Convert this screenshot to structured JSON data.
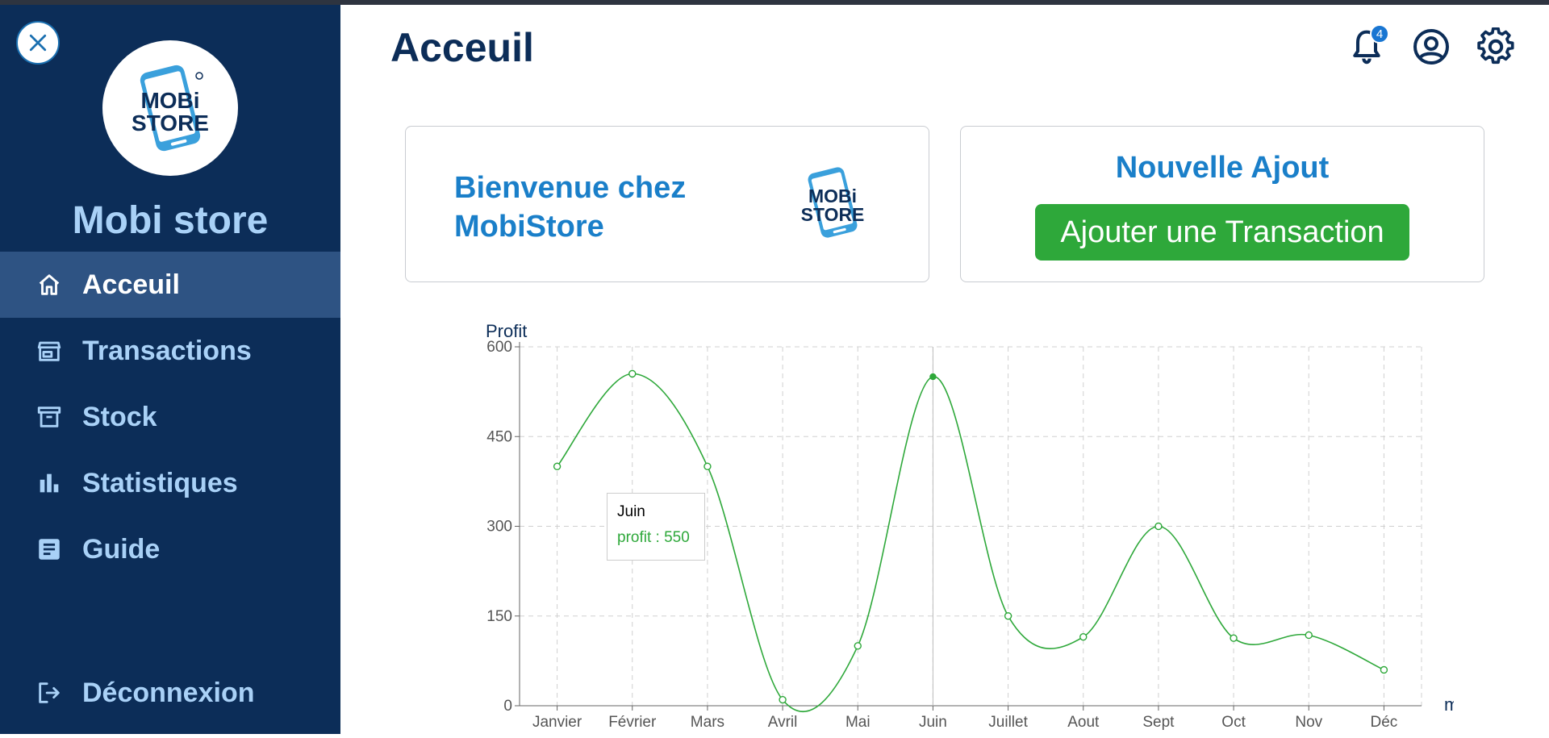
{
  "sidebar": {
    "brand": "Mobi store",
    "logo_text_top": "MOBi",
    "logo_text_bottom": "STORE",
    "items": [
      {
        "label": "Acceuil",
        "icon": "home-icon",
        "active": true
      },
      {
        "label": "Transactions",
        "icon": "store-icon",
        "active": false
      },
      {
        "label": "Stock",
        "icon": "archive-icon",
        "active": false
      },
      {
        "label": "Statistiques",
        "icon": "bar-chart-icon",
        "active": false
      },
      {
        "label": "Guide",
        "icon": "article-icon",
        "active": false
      }
    ],
    "logout_label": "Déconnexion"
  },
  "header": {
    "title": "Acceuil",
    "notification_count": "4"
  },
  "cards": {
    "welcome": "Bienvenue chez MobiStore",
    "new_title": "Nouvelle Ajout",
    "add_button": "Ajouter une Transaction"
  },
  "colors": {
    "sidebar_bg": "#0c2d58",
    "accent_blue": "#1a7fc9",
    "green": "#2ea83a"
  },
  "chart_data": {
    "type": "line",
    "ylabel": "Profit",
    "xlabel": "mois",
    "ylim": [
      0,
      600
    ],
    "yticks": [
      0,
      150,
      300,
      450,
      600
    ],
    "categories": [
      "Janvier",
      "Février",
      "Mars",
      "Avril",
      "Mai",
      "Juin",
      "Juillet",
      "Aout",
      "Sept",
      "Oct",
      "Nov",
      "Déc"
    ],
    "series": [
      {
        "name": "profit",
        "color": "#2ea83a",
        "values": [
          400,
          555,
          400,
          10,
          100,
          550,
          150,
          115,
          300,
          113,
          118,
          60
        ]
      }
    ],
    "grid": true,
    "tooltip": {
      "label": "Juin",
      "text": "profit : 550"
    }
  }
}
